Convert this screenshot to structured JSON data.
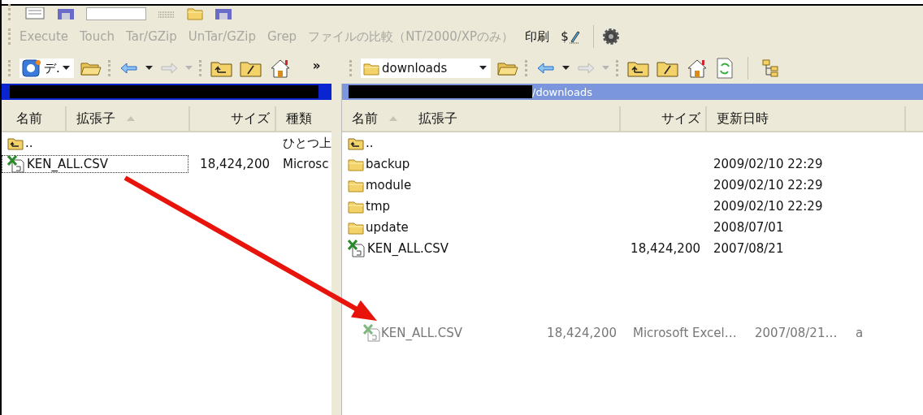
{
  "command_toolbar": {
    "items": [
      {
        "label": "Execute",
        "disabled": true
      },
      {
        "label": "Touch",
        "disabled": true
      },
      {
        "label": "Tar/GZip",
        "disabled": true
      },
      {
        "label": "UnTar/GZip",
        "disabled": true
      },
      {
        "label": "Grep",
        "disabled": true
      },
      {
        "label": "ファイルの比較（NT/2000/XPのみ）",
        "disabled": true
      },
      {
        "label": "印刷",
        "disabled": false
      }
    ],
    "script_button": "$"
  },
  "left_pane": {
    "drive_combo": "デ.",
    "overflow": "»",
    "columns": [
      {
        "label": "名前",
        "sorted": false
      },
      {
        "label": "拡張子",
        "sorted": true
      },
      {
        "label": "サイズ",
        "sorted": false
      },
      {
        "label": "種類",
        "sorted": false
      }
    ],
    "rows": [
      {
        "kind": "parent",
        "name": "..",
        "type": "ひとつ上",
        "selected": false
      },
      {
        "kind": "file",
        "name": "KEN_ALL.CSV",
        "size": "18,424,200",
        "type": "Microsc",
        "selected": true
      }
    ]
  },
  "right_pane": {
    "folder_combo": "downloads",
    "path": "/downloads",
    "columns": [
      {
        "label": "名前",
        "sorted": true
      },
      {
        "label": "拡張子",
        "sorted": false
      },
      {
        "label": "サイズ",
        "sorted": false
      },
      {
        "label": "更新日時",
        "sorted": false
      }
    ],
    "rows": [
      {
        "kind": "parent",
        "name": "..",
        "selected": false
      },
      {
        "kind": "folder",
        "name": "backup",
        "date": "2009/02/10 22:29",
        "selected": false
      },
      {
        "kind": "folder",
        "name": "module",
        "date": "2009/02/10 22:29",
        "selected": false
      },
      {
        "kind": "folder",
        "name": "tmp",
        "date": "2009/02/10 22:29",
        "selected": false
      },
      {
        "kind": "folder",
        "name": "update",
        "date": "2008/07/01",
        "selected": false
      },
      {
        "kind": "file",
        "name": "KEN_ALL.CSV",
        "size": "18,424,200",
        "date": "2007/08/21",
        "selected": false
      }
    ]
  },
  "drag_ghost": {
    "name": "KEN_ALL.CSV",
    "size": "18,424,200",
    "type": "Microsoft Excel…",
    "date": "2007/08/21…",
    "attribute": "a"
  }
}
